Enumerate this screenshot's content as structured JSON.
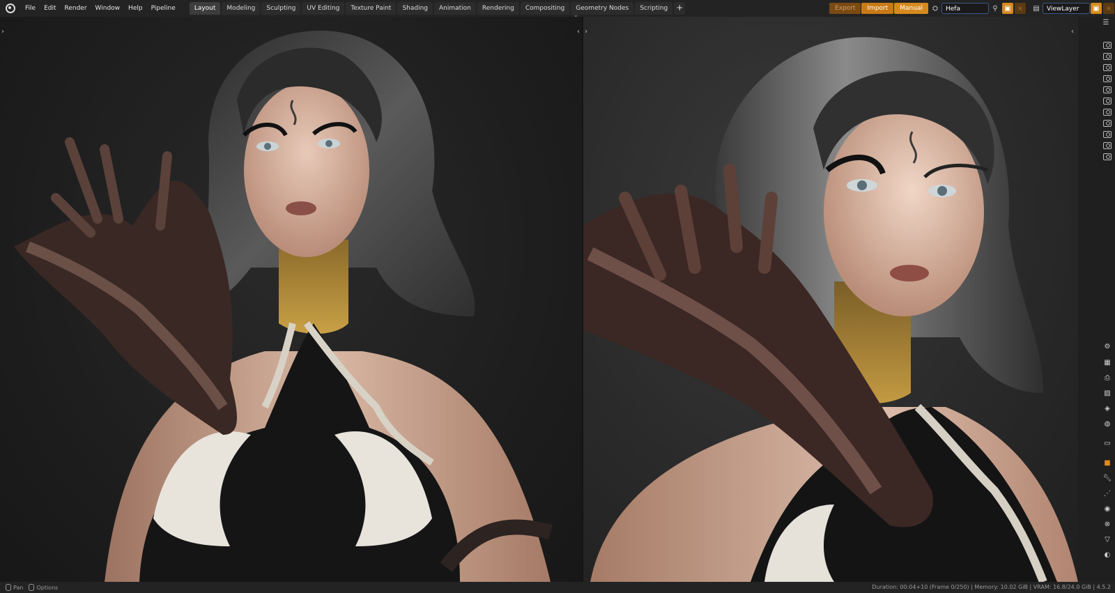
{
  "menu": [
    "File",
    "Edit",
    "Render",
    "Window",
    "Help",
    "Pipeline"
  ],
  "workspaces": [
    "Layout",
    "Modeling",
    "Sculpting",
    "UV Editing",
    "Texture Paint",
    "Shading",
    "Animation",
    "Rendering",
    "Compositing",
    "Geometry Nodes",
    "Scripting"
  ],
  "active_workspace": "Layout",
  "pipeline": {
    "export": "Export",
    "import": "Import",
    "manual": "Manual"
  },
  "scene": {
    "name": "Hefa"
  },
  "view_layer": {
    "name": "ViewLayer"
  },
  "status": {
    "left": [
      {
        "label": "Pan"
      },
      {
        "label": "Options"
      }
    ],
    "info": "Duration: 00:04+10 (Frame 0/250) | Memory: 10.02 GiB | VRAM: 16.8/24.0 GiB | 4.5.2"
  },
  "icons": {
    "logo": "blender-logo-icon",
    "add": "plus-icon",
    "properties": [
      "tool-icon",
      "render-icon",
      "output-icon",
      "view-layer-icon",
      "scene-icon",
      "world-icon",
      "collection-icon",
      "object-icon",
      "modifier-icon",
      "particles-icon",
      "physics-icon",
      "constraints-icon",
      "data-icon",
      "material-icon"
    ]
  },
  "colors": {
    "accent": "#d68a1e",
    "field_border": "#3a5a8a",
    "bg": "#1d1d1d"
  }
}
